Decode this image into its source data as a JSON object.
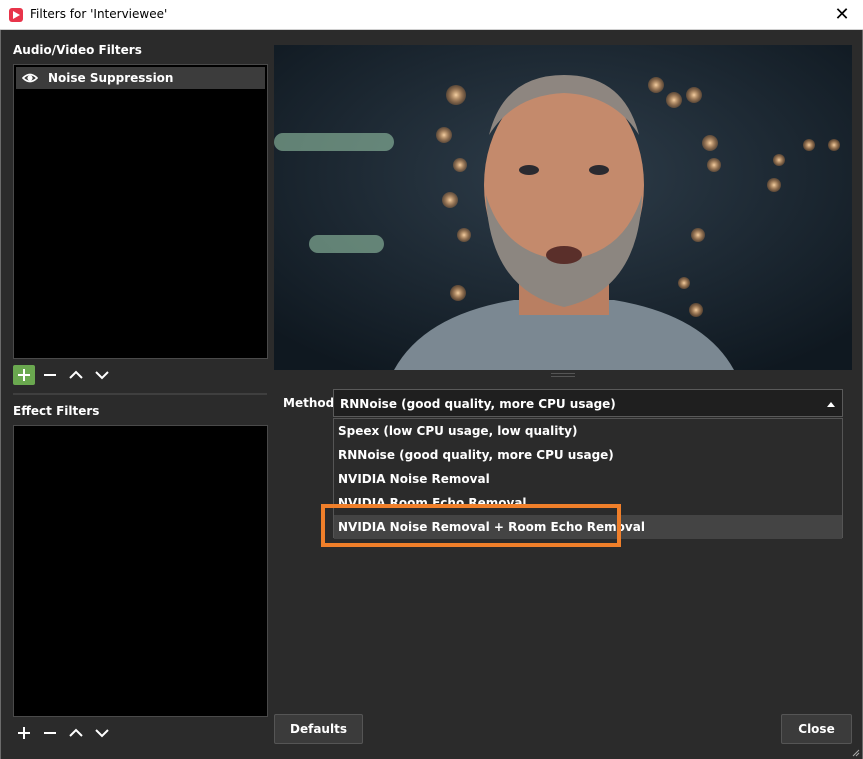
{
  "window": {
    "title": "Filters for 'Interviewee'",
    "close_glyph": "✕"
  },
  "audio_video": {
    "label": "Audio/Video Filters",
    "items": [
      {
        "label": "Noise Suppression",
        "visible_icon": "eye-icon"
      }
    ]
  },
  "effect": {
    "label": "Effect Filters",
    "items": []
  },
  "method": {
    "label": "Method",
    "selected": "RNNoise (good quality, more CPU usage)",
    "options": [
      "Speex (low CPU usage, low quality)",
      "RNNoise (good quality, more CPU usage)",
      "NVIDIA Noise Removal",
      "NVIDIA Room Echo Removal",
      "NVIDIA Noise Removal + Room Echo Removal"
    ]
  },
  "buttons": {
    "defaults": "Defaults",
    "close": "Close"
  },
  "colors": {
    "accent_green": "#6aa84f",
    "highlight_orange": "#f07f2a"
  }
}
